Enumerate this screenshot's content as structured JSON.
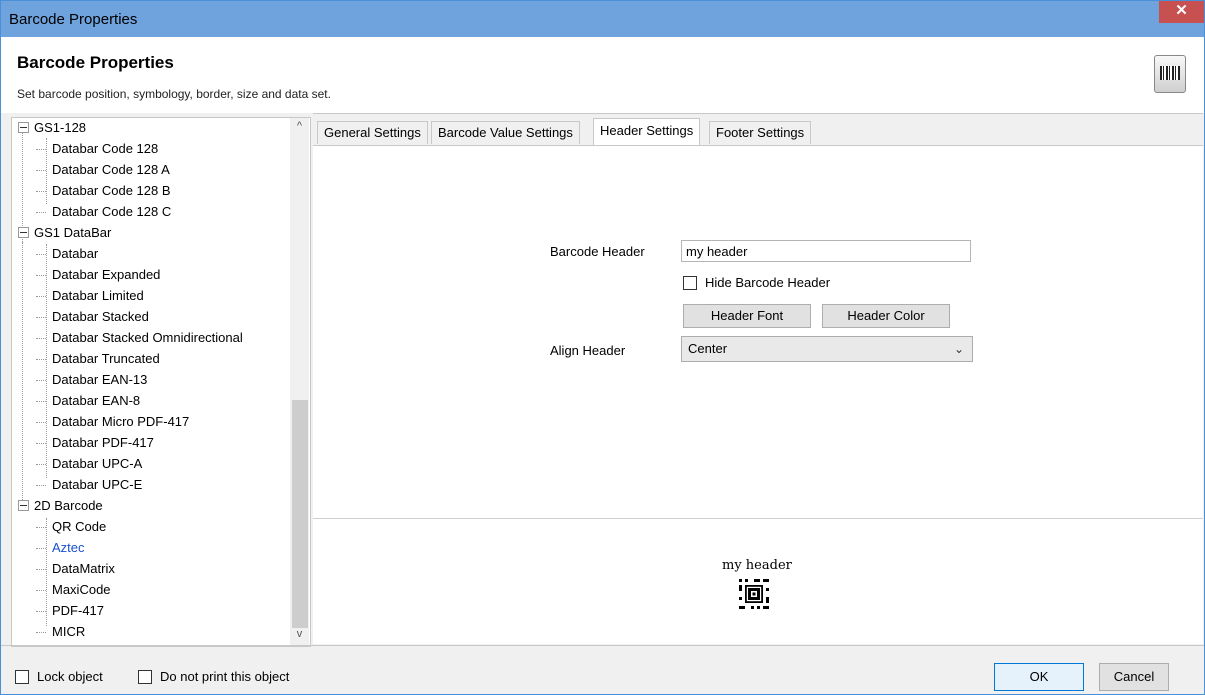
{
  "window": {
    "title": "Barcode Properties",
    "close_glyph": "✕"
  },
  "header": {
    "title": "Barcode Properties",
    "description": "Set barcode position, symbology, border, size and data set.",
    "icon": "barcode-scanner-icon"
  },
  "tree": {
    "groups": [
      {
        "label": "GS1-128",
        "children": [
          "Databar Code 128",
          "Databar Code 128 A",
          "Databar Code 128 B",
          "Databar Code 128 C"
        ]
      },
      {
        "label": "GS1 DataBar",
        "children": [
          "Databar",
          "Databar Expanded",
          "Databar Limited",
          "Databar Stacked",
          "Databar Stacked Omnidirectional",
          "Databar Truncated",
          "Databar EAN-13",
          "Databar EAN-8",
          "Databar Micro PDF-417",
          "Databar PDF-417",
          "Databar UPC-A",
          "Databar UPC-E"
        ]
      },
      {
        "label": "2D Barcode",
        "children": [
          "QR Code",
          "Aztec",
          "DataMatrix",
          "MaxiCode",
          "PDF-417",
          "MICR"
        ]
      }
    ],
    "selected": "Aztec",
    "selected_color": "#1a4fcf",
    "scroll_up": "^",
    "scroll_down": "v"
  },
  "tabs": [
    {
      "label": "General Settings",
      "active": false
    },
    {
      "label": "Barcode Value Settings",
      "active": false
    },
    {
      "label": "Header Settings",
      "active": true
    },
    {
      "label": "Footer Settings",
      "active": false
    }
  ],
  "header_settings": {
    "barcode_header_label": "Barcode Header",
    "barcode_header_value": "my header",
    "hide_header_label": "Hide Barcode Header",
    "hide_header_checked": false,
    "header_font_button": "Header Font",
    "header_color_button": "Header Color",
    "align_header_label": "Align Header",
    "align_header_value": "Center"
  },
  "preview": {
    "header_text": "my header"
  },
  "footer": {
    "lock_object_label": "Lock object",
    "lock_object_checked": false,
    "do_not_print_label": "Do not print this object",
    "do_not_print_checked": false,
    "ok_label": "OK",
    "cancel_label": "Cancel"
  }
}
